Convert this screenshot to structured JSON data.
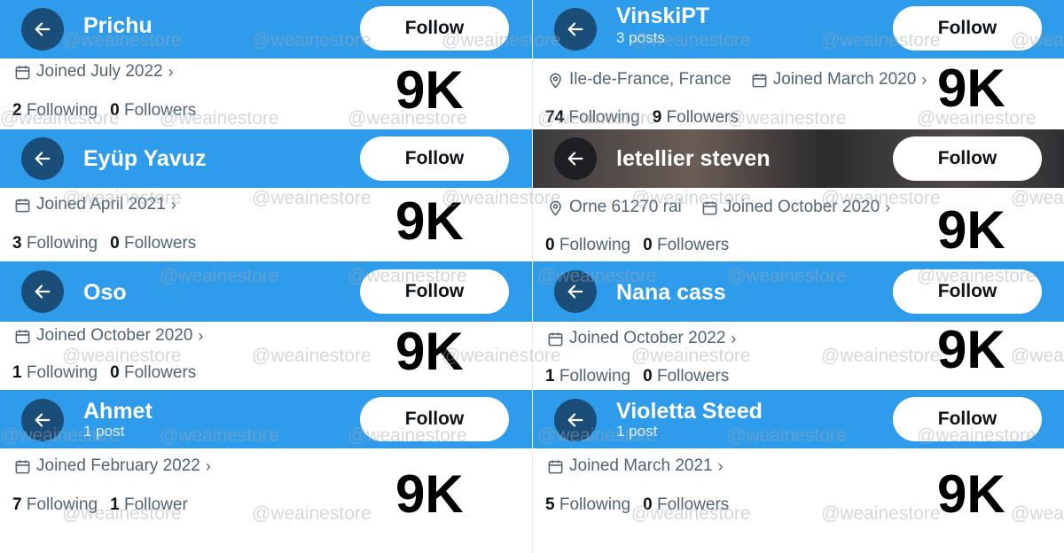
{
  "watermark": "@weainestore",
  "follow_label": "Follow",
  "big_count": "9K",
  "left": [
    {
      "name": "Prichu",
      "posts": "",
      "joined": "Joined July 2022",
      "location": "",
      "following": "2",
      "following_label": "Following",
      "followers": "0",
      "followers_label": "Followers"
    },
    {
      "name": "Eyüp Yavuz",
      "posts": "",
      "joined": "Joined April 2021",
      "location": "",
      "following": "3",
      "following_label": "Following",
      "followers": "0",
      "followers_label": "Followers"
    },
    {
      "name": "Oso",
      "posts": "",
      "joined": "Joined October 2020",
      "location": "",
      "following": "1",
      "following_label": "Following",
      "followers": "0",
      "followers_label": "Followers"
    },
    {
      "name": "Ahmet",
      "posts": "1 post",
      "joined": "Joined February 2022",
      "location": "",
      "following": "7",
      "following_label": "Following",
      "followers": "1",
      "followers_label": "Follower"
    }
  ],
  "right": [
    {
      "name": "VinskiPT",
      "posts": "3 posts",
      "joined": "Joined March 2020",
      "location": "Ile-de-France, France",
      "following": "74",
      "following_label": "Following",
      "followers": "9",
      "followers_label": "Followers"
    },
    {
      "name": "letellier steven",
      "posts": "",
      "joined": "Joined October 2020",
      "location": "Orne 61270 rai",
      "following": "0",
      "following_label": "Following",
      "followers": "0",
      "followers_label": "Followers"
    },
    {
      "name": "Nana cass",
      "posts": "",
      "joined": "Joined October 2022",
      "location": "",
      "following": "1",
      "following_label": "Following",
      "followers": "0",
      "followers_label": "Followers"
    },
    {
      "name": "Violetta Steed",
      "posts": "1 post",
      "joined": "Joined March 2021",
      "location": "",
      "following": "5",
      "following_label": "Following",
      "followers": "0",
      "followers_label": "Followers"
    }
  ],
  "colors": {
    "banner": "#2f9ceb",
    "back_button": "#1a4d78",
    "text_secondary": "#536471",
    "text_primary": "#0f1419"
  },
  "icons": {
    "back": "arrow-left-icon",
    "calendar": "calendar-icon",
    "location": "location-pin-icon"
  }
}
